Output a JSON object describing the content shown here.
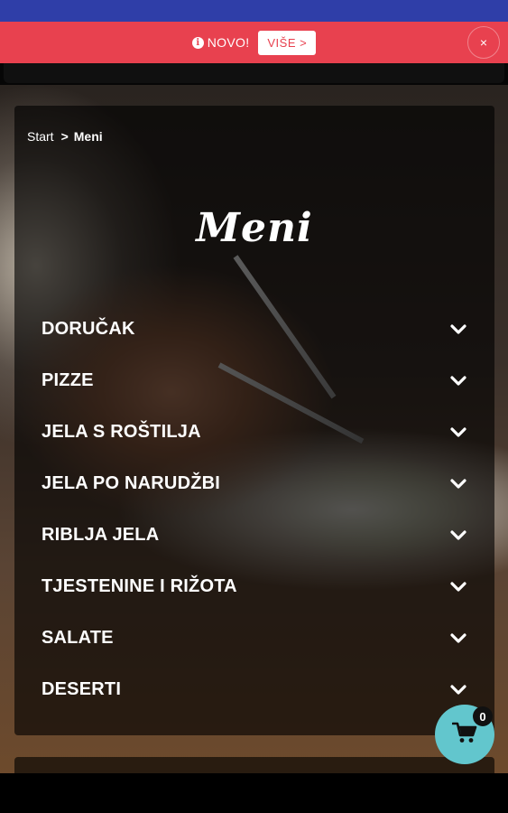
{
  "notice": {
    "text": "NOVO!",
    "more_label": "VIŠE >",
    "close_label": "×",
    "info_glyph": "i",
    "bg_color": "#e8414f"
  },
  "breadcrumb": {
    "home": "Start",
    "separator": ">",
    "current": "Meni"
  },
  "page_title": "Meni",
  "menu": {
    "items": [
      {
        "label": "DORUČAK",
        "icon": "chevron-down-icon"
      },
      {
        "label": "PIZZE",
        "icon": "chevron-down-icon"
      },
      {
        "label": "JELA S ROŠTILJA",
        "icon": "chevron-down-icon"
      },
      {
        "label": "JELA PO NARUDŽBI",
        "icon": "chevron-down-icon"
      },
      {
        "label": "RIBLJA JELA",
        "icon": "chevron-down-icon"
      },
      {
        "label": "TJESTENINE I RIŽOTA",
        "icon": "chevron-down-icon"
      },
      {
        "label": "SALATE",
        "icon": "chevron-down-icon"
      },
      {
        "label": "DESERTI",
        "icon": "chevron-down-icon"
      }
    ]
  },
  "cart": {
    "count": "0",
    "icon": "cart-icon",
    "color": "#62c6cd"
  },
  "colors": {
    "status_bar": "#2f3ea8",
    "accent": "#e8414f"
  }
}
